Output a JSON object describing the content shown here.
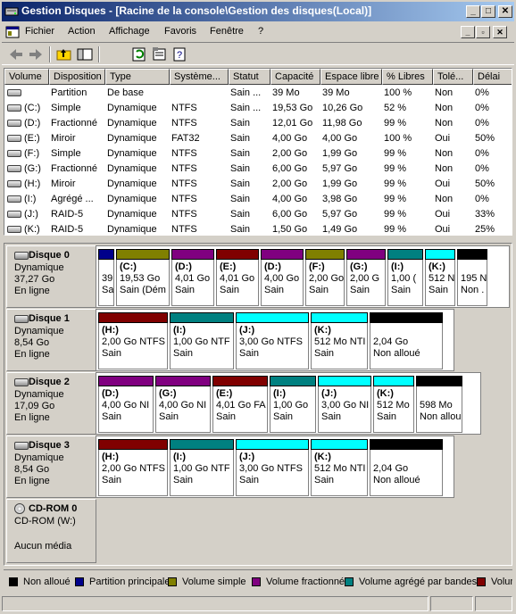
{
  "window": {
    "title": "Gestion Disques - [Racine de la console\\Gestion des disques(Local)]",
    "minimize_glyph": "_",
    "maximize_glyph": "□",
    "close_glyph": "✕"
  },
  "menu": [
    {
      "label": "Fichier"
    },
    {
      "label": "Action"
    },
    {
      "label": "Affichage"
    },
    {
      "label": "Favoris"
    },
    {
      "label": "Fenêtre"
    },
    {
      "label": "?"
    }
  ],
  "toolbar": [
    "back-icon",
    "forward-icon",
    "up-folder-icon",
    "show-hide-tree-icon",
    "refresh-icon",
    "properties-icon",
    "help-icon"
  ],
  "colors": {
    "unallocated": "#000000",
    "primary": "#00008b",
    "simple": "#808000",
    "striped": "#800080",
    "spanned": "#008080",
    "mirror": "#800000",
    "raid5": "#00ffff"
  },
  "columns": [
    "Volume",
    "Disposition",
    "Type",
    "Système...",
    "Statut",
    "Capacité",
    "Espace libre",
    "% Libres",
    "Tolé...",
    "Délai"
  ],
  "volumes": [
    {
      "volume": "",
      "layout": "Partition",
      "type": "De base",
      "fs": "",
      "status": "Sain ...",
      "capacity": "39 Mo",
      "free": "39 Mo",
      "pct": "100 %",
      "ft": "Non",
      "overhead": "0%"
    },
    {
      "volume": "(C:)",
      "layout": "Simple",
      "type": "Dynamique",
      "fs": "NTFS",
      "status": "Sain ...",
      "capacity": "19,53 Go",
      "free": "10,26 Go",
      "pct": "52 %",
      "ft": "Non",
      "overhead": "0%"
    },
    {
      "volume": "(D:)",
      "layout": "Fractionné",
      "type": "Dynamique",
      "fs": "NTFS",
      "status": "Sain",
      "capacity": "12,01 Go",
      "free": "11,98 Go",
      "pct": "99 %",
      "ft": "Non",
      "overhead": "0%"
    },
    {
      "volume": "(E:)",
      "layout": "Miroir",
      "type": "Dynamique",
      "fs": "FAT32",
      "status": "Sain",
      "capacity": "4,00 Go",
      "free": "4,00 Go",
      "pct": "100 %",
      "ft": "Oui",
      "overhead": "50%"
    },
    {
      "volume": "(F:)",
      "layout": "Simple",
      "type": "Dynamique",
      "fs": "NTFS",
      "status": "Sain",
      "capacity": "2,00 Go",
      "free": "1,99 Go",
      "pct": "99 %",
      "ft": "Non",
      "overhead": "0%"
    },
    {
      "volume": "(G:)",
      "layout": "Fractionné",
      "type": "Dynamique",
      "fs": "NTFS",
      "status": "Sain",
      "capacity": "6,00 Go",
      "free": "5,97 Go",
      "pct": "99 %",
      "ft": "Non",
      "overhead": "0%"
    },
    {
      "volume": "(H:)",
      "layout": "Miroir",
      "type": "Dynamique",
      "fs": "NTFS",
      "status": "Sain",
      "capacity": "2,00 Go",
      "free": "1,99 Go",
      "pct": "99 %",
      "ft": "Oui",
      "overhead": "50%"
    },
    {
      "volume": "(I:)",
      "layout": "Agrégé ...",
      "type": "Dynamique",
      "fs": "NTFS",
      "status": "Sain",
      "capacity": "4,00 Go",
      "free": "3,98 Go",
      "pct": "99 %",
      "ft": "Non",
      "overhead": "0%"
    },
    {
      "volume": "(J:)",
      "layout": "RAID-5",
      "type": "Dynamique",
      "fs": "NTFS",
      "status": "Sain",
      "capacity": "6,00 Go",
      "free": "5,97 Go",
      "pct": "99 %",
      "ft": "Oui",
      "overhead": "33%"
    },
    {
      "volume": "(K:)",
      "layout": "RAID-5",
      "type": "Dynamique",
      "fs": "NTFS",
      "status": "Sain",
      "capacity": "1,50 Go",
      "free": "1,49 Go",
      "pct": "99 %",
      "ft": "Oui",
      "overhead": "25%"
    }
  ],
  "disks": [
    {
      "name": "Disque 0",
      "type": "Dynamique",
      "size": "37,27 Go",
      "state": "En ligne",
      "icon": "disk-icon",
      "partitions": [
        {
          "color": "primary",
          "label": "",
          "l1": "39",
          "l2": "Sa"
        },
        {
          "color": "simple",
          "label": "(C:)",
          "l1": "19,53 Go",
          "l2": "Sain (Dém"
        },
        {
          "color": "striped",
          "label": "(D:)",
          "l1": "4,01 Go",
          "l2": "Sain"
        },
        {
          "color": "mirror",
          "label": "(E:)",
          "l1": "4,01 Go",
          "l2": "Sain"
        },
        {
          "color": "striped",
          "label": "(D:)",
          "l1": "4,00 Go",
          "l2": "Sain"
        },
        {
          "color": "simple",
          "label": "(F:)",
          "l1": "2,00 Go",
          "l2": "Sain"
        },
        {
          "color": "striped",
          "label": "(G:)",
          "l1": "2,00 G",
          "l2": "Sain"
        },
        {
          "color": "spanned",
          "label": "(I:)",
          "l1": "1,00 (",
          "l2": "Sain"
        },
        {
          "color": "raid5",
          "label": "(K:)",
          "l1": "512 N",
          "l2": "Sain"
        },
        {
          "color": "unallocated",
          "label": "",
          "l1": "195 N",
          "l2": "Non ."
        }
      ]
    },
    {
      "name": "Disque 1",
      "type": "Dynamique",
      "size": "8,54 Go",
      "state": "En ligne",
      "icon": "disk-icon",
      "partitions": [
        {
          "color": "mirror",
          "label": "(H:)",
          "l1": "2,00 Go NTFS",
          "l2": "Sain"
        },
        {
          "color": "spanned",
          "label": "(I:)",
          "l1": "1,00 Go NTF",
          "l2": "Sain"
        },
        {
          "color": "raid5",
          "label": "(J:)",
          "l1": "3,00 Go NTFS",
          "l2": "Sain"
        },
        {
          "color": "raid5",
          "label": "(K:)",
          "l1": "512 Mo NTI",
          "l2": "Sain"
        },
        {
          "color": "unallocated",
          "label": "",
          "l1": "2,04 Go",
          "l2": "Non alloué"
        }
      ]
    },
    {
      "name": "Disque 2",
      "type": "Dynamique",
      "size": "17,09 Go",
      "state": "En ligne",
      "icon": "disk-icon",
      "partitions": [
        {
          "color": "striped",
          "label": "(D:)",
          "l1": "4,00 Go NI",
          "l2": "Sain"
        },
        {
          "color": "striped",
          "label": "(G:)",
          "l1": "4,00 Go NI",
          "l2": "Sain"
        },
        {
          "color": "mirror",
          "label": "(E:)",
          "l1": "4,01 Go FA",
          "l2": "Sain"
        },
        {
          "color": "spanned",
          "label": "(I:)",
          "l1": "1,00 Go",
          "l2": "Sain"
        },
        {
          "color": "raid5",
          "label": "(J:)",
          "l1": "3,00 Go NI",
          "l2": "Sain"
        },
        {
          "color": "raid5",
          "label": "(K:)",
          "l1": "512 Mo",
          "l2": "Sain"
        },
        {
          "color": "unallocated",
          "label": "",
          "l1": "598 Mo",
          "l2": "Non allou"
        }
      ]
    },
    {
      "name": "Disque 3",
      "type": "Dynamique",
      "size": "8,54 Go",
      "state": "En ligne",
      "icon": "disk-icon",
      "partitions": [
        {
          "color": "mirror",
          "label": "(H:)",
          "l1": "2,00 Go NTFS",
          "l2": "Sain"
        },
        {
          "color": "spanned",
          "label": "(I:)",
          "l1": "1,00 Go NTF",
          "l2": "Sain"
        },
        {
          "color": "raid5",
          "label": "(J:)",
          "l1": "3,00 Go NTFS",
          "l2": "Sain"
        },
        {
          "color": "raid5",
          "label": "(K:)",
          "l1": "512 Mo NTI",
          "l2": "Sain"
        },
        {
          "color": "unallocated",
          "label": "",
          "l1": "2,04 Go",
          "l2": "Non alloué"
        }
      ]
    },
    {
      "name": "CD-ROM 0",
      "type": "CD-ROM (W:)",
      "size": "",
      "state": "Aucun média",
      "icon": "cdrom-icon",
      "partitions": []
    }
  ],
  "legend": [
    {
      "color": "unallocated",
      "label": "Non alloué"
    },
    {
      "color": "primary",
      "label": "Partition principale"
    },
    {
      "color": "simple",
      "label": "Volume simple"
    },
    {
      "color": "striped",
      "label": "Volume fractionné"
    },
    {
      "color": "spanned",
      "label": "Volume agrégé par bandes"
    },
    {
      "color": "mirror",
      "label": "Volume en miroir"
    }
  ]
}
